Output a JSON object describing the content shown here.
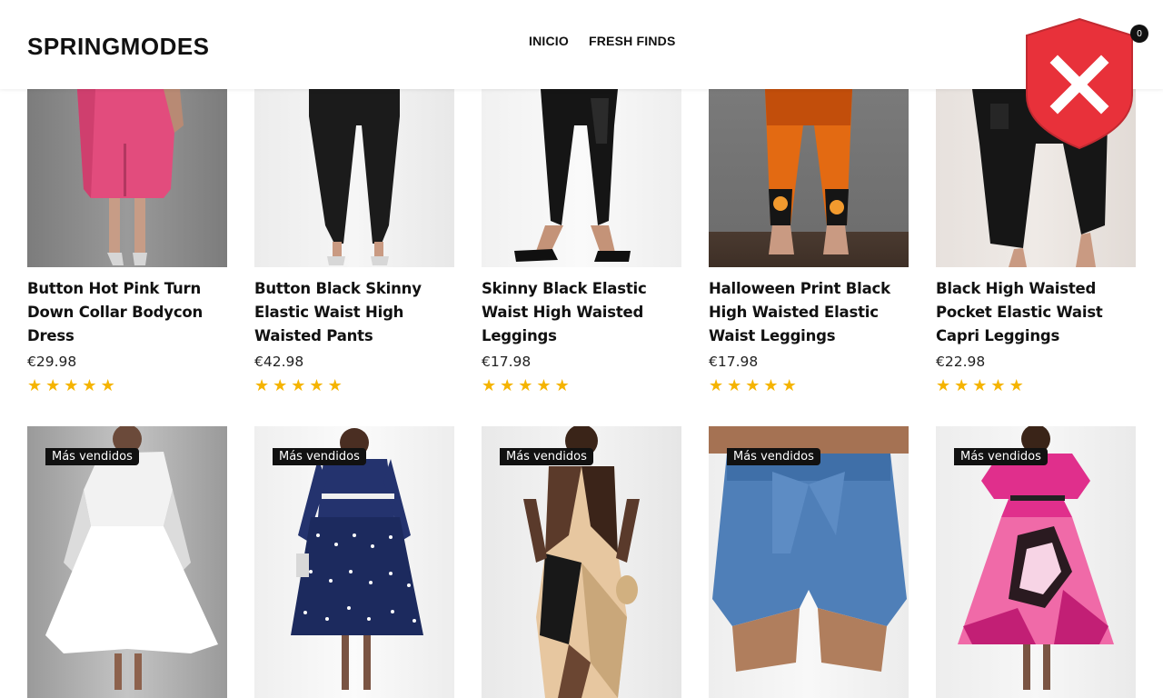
{
  "header": {
    "logo": "SPRINGMODES",
    "nav": [
      "INICIO",
      "FRESH FINDS"
    ],
    "cart_count": "0"
  },
  "colors": {
    "star": "#f5b400",
    "shield": "#e8313a",
    "badge_bg": "#111111"
  },
  "row1": [
    {
      "title": "Button Hot Pink Turn Down Collar Bodycon Dress",
      "price": "€29.98",
      "rating": 5
    },
    {
      "title": "Button Black Skinny Elastic Waist High Waisted Pants",
      "price": "€42.98",
      "rating": 5
    },
    {
      "title": "Skinny Black Elastic Waist High Waisted Leggings",
      "price": "€17.98",
      "rating": 5
    },
    {
      "title": "Halloween Print Black High Waisted Elastic Waist Leggings",
      "price": "€17.98",
      "rating": 5
    },
    {
      "title": "Black High Waisted Pocket Elastic Waist Capri Leggings",
      "price": "€22.98",
      "rating": 5
    }
  ],
  "row2": [
    {
      "badge": "Más vendidos"
    },
    {
      "badge": "Más vendidos"
    },
    {
      "badge": "Más vendidos"
    },
    {
      "badge": "Más vendidos"
    },
    {
      "badge": "Más vendidos"
    }
  ]
}
